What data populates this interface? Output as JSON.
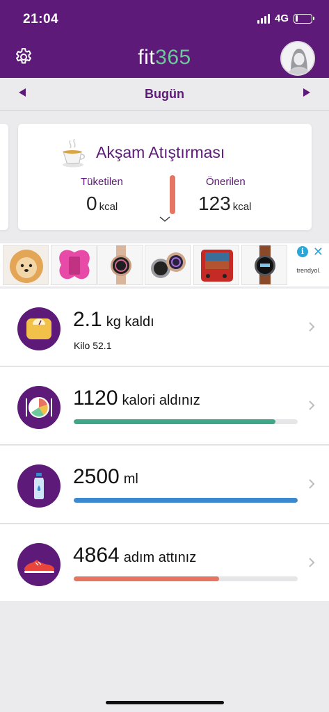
{
  "status_bar": {
    "time": "21:04",
    "network": "4G",
    "battery_level": 0.15
  },
  "header": {
    "logo_prefix": "fit",
    "logo_number": "365",
    "logo_number_color": "#6ec89a",
    "brand_color": "#5e1a78"
  },
  "day_nav": {
    "title": "Bugün"
  },
  "meal_card": {
    "title": "Akşam Atıştırması",
    "consumed_label": "Tüketilen",
    "consumed_value": "0",
    "consumed_unit": "kcal",
    "recommended_label": "Önerilen",
    "recommended_value": "123",
    "recommended_unit": "kcal"
  },
  "ad": {
    "brand_name": "trendyol",
    "info_label": "i",
    "close_label": "✕",
    "items": [
      "pomeranian-puppy",
      "pink-butterfly-tablet-case",
      "rose-gold-smartwatch",
      "smartwatch-pair",
      "retro-handheld-console",
      "brown-leather-smartwatch"
    ]
  },
  "trackers": {
    "weight": {
      "value": "2.1",
      "suffix": "kg kaldı",
      "sub": "Kilo 52.1",
      "icon": "scale-icon"
    },
    "calories": {
      "value": "1120",
      "suffix": "kalori aldınız",
      "progress": 0.9,
      "color": "#3fa788",
      "icon": "plate-icon"
    },
    "water": {
      "value": "2500",
      "suffix": "ml",
      "progress": 1.0,
      "color": "#3b88cf",
      "icon": "bottle-icon"
    },
    "steps": {
      "value": "4864",
      "suffix": "adım attınız",
      "progress": 0.65,
      "color": "#e57561",
      "icon": "sneaker-icon"
    }
  }
}
